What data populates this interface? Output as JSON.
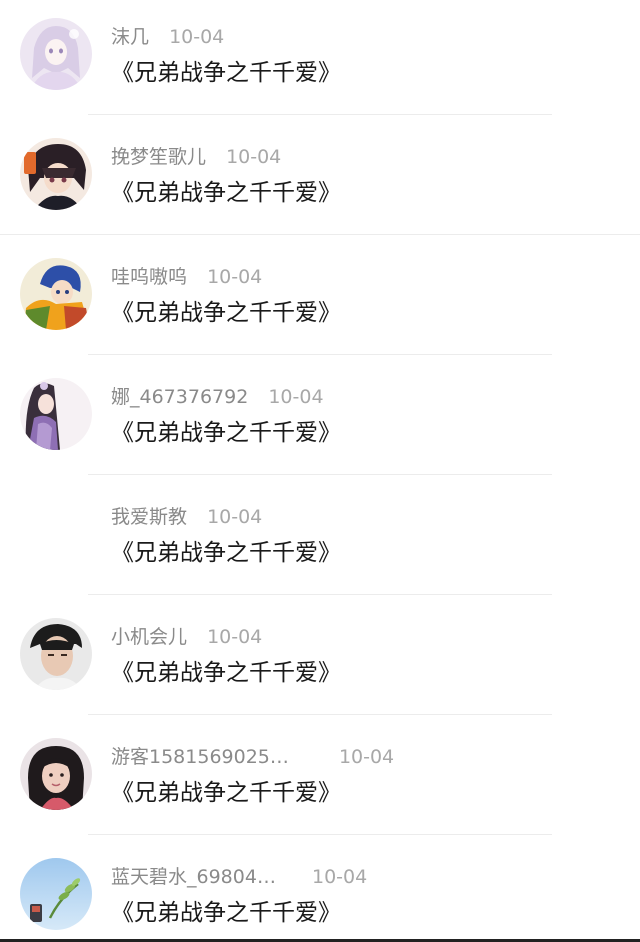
{
  "comments": [
    {
      "user": "沫几",
      "date": "10-04",
      "text": "《兄弟战争之千千爱》",
      "avatar": "anime-girl-avatar-pastel"
    },
    {
      "user": "挽梦笙歌儿",
      "date": "10-04",
      "text": "《兄弟战争之千千爱》",
      "avatar": "anime-boy-avatar-dark"
    },
    {
      "user": "哇呜嗷呜",
      "date": "10-04",
      "text": "《兄弟战争之千千爱》",
      "avatar": "anime-boy-avatar-blue-hair"
    },
    {
      "user": "娜_467376792",
      "date": "10-04",
      "text": "《兄弟战争之千千爱》",
      "avatar": "anime-girl-avatar-purple"
    },
    {
      "user": "我爱斯教",
      "date": "10-04",
      "text": "《兄弟战争之千千爱》",
      "avatar": ""
    },
    {
      "user": "小机会儿",
      "date": "10-04",
      "text": "《兄弟战争之千千爱》",
      "avatar": "photo-avatar-young-man"
    },
    {
      "user": "游客1581569025…",
      "date": "10-04",
      "text": "《兄弟战争之千千爱》",
      "avatar": "photo-avatar-young-woman"
    },
    {
      "user": "蓝天碧水_69804…",
      "date": "10-04",
      "text": "《兄弟战争之千千爱》",
      "avatar": "sky-plant-avatar"
    }
  ],
  "colors": {
    "username": "#8a8a8a",
    "date": "#a8a8a8",
    "comment_text": "#1a1a1a",
    "divider": "#ececec"
  }
}
